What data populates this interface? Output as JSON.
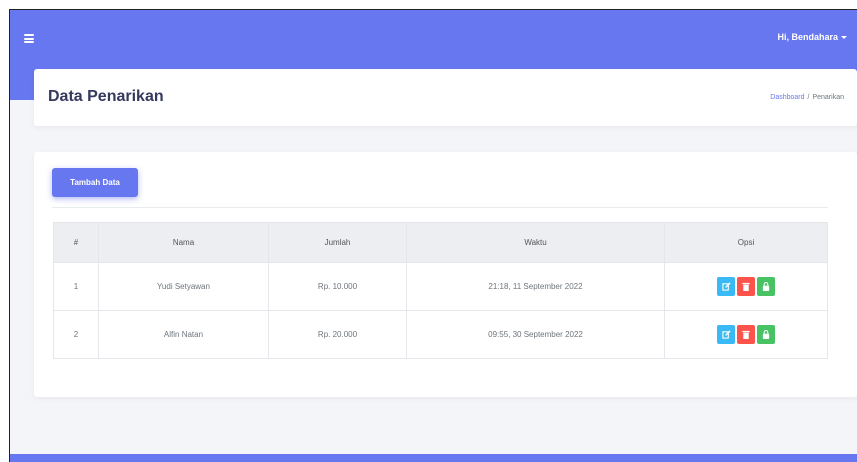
{
  "topbar": {
    "user_greeting": "Hi, Bendahara"
  },
  "header": {
    "title": "Data Penarikan",
    "breadcrumb": {
      "link": "Dashboard",
      "separator": "/",
      "current": "Penarikan"
    }
  },
  "content": {
    "add_button_label": "Tambah Data",
    "table": {
      "headers": [
        "#",
        "Nama",
        "Jumlah",
        "Waktu",
        "Opsi"
      ],
      "rows": [
        {
          "no": "1",
          "nama": "Yudi Setyawan",
          "jumlah": "Rp. 10.000",
          "waktu": "21:18, 11 September 2022"
        },
        {
          "no": "2",
          "nama": "Alfin Natan",
          "jumlah": "Rp. 20.000",
          "waktu": "09:55, 30 September 2022"
        }
      ]
    }
  },
  "colors": {
    "primary": "#6777ef",
    "info": "#3abaf4",
    "danger": "#fc544b",
    "success": "#47c363"
  },
  "icons": {
    "menu": "hamburger-icon",
    "edit": "edit-icon",
    "delete": "trash-icon",
    "lock": "lock-icon"
  }
}
